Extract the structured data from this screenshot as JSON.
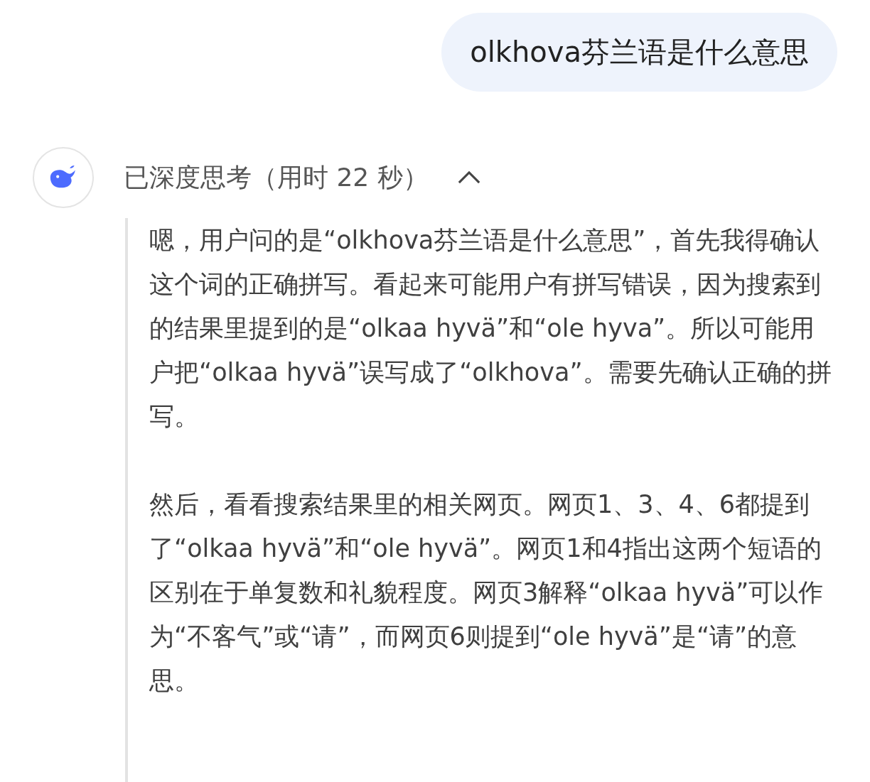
{
  "user_message": {
    "text": "olkhova芬兰语是什么意思"
  },
  "thinking": {
    "title": "已深度思考（用时 22 秒）",
    "expanded": true,
    "paragraphs": [
      "嗯，用户问的是“olkhova芬兰语是什么意思”，首先我得确认这个词的正确拼写。看起来可能用户有拼写错误，因为搜索到的结果里提到的是“olkaa hyvä”和“ole hyva”。所以可能用户把“olkaa hyvä”误写成了“olkhova”。需要先确认正确的拼写。",
      "然后，看看搜索结果里的相关网页。网页1、3、4、6都提到了“olkaa hyvä”和“ole hyvä”。网页1和4指出这两个短语的区别在于单复数和礼貌程度。网页3解释“olkaa hyvä”可以作为“不客气”或“请”，而网页6则提到“ole hyvä”是“请”的意思。"
    ]
  }
}
